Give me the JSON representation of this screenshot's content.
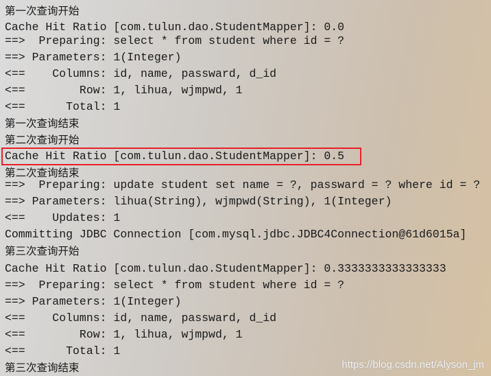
{
  "lines": [
    "第一次查询开始",
    "Cache Hit Ratio [com.tulun.dao.StudentMapper]: 0.0",
    "==>  Preparing: select * from student where id = ?",
    "==> Parameters: 1(Integer)",
    "<==    Columns: id, name, passward, d_id",
    "<==        Row: 1, lihua, wjmpwd, 1",
    "<==      Total: 1",
    "第一次查询结束",
    "第二次查询开始",
    "Cache Hit Ratio [com.tulun.dao.StudentMapper]: 0.5",
    "第二次查询结束",
    "==>  Preparing: update student set name = ?, passward = ? where id = ?",
    "==> Parameters: lihua(String), wjmpwd(String), 1(Integer)",
    "<==    Updates: 1",
    "Committing JDBC Connection [com.mysql.jdbc.JDBC4Connection@61d6015a]",
    "第三次查询开始",
    "Cache Hit Ratio [com.tulun.dao.StudentMapper]: 0.3333333333333333",
    "==>  Preparing: select * from student where id = ?",
    "==> Parameters: 1(Integer)",
    "<==    Columns: id, name, passward, d_id",
    "<==        Row: 1, lihua, wjmpwd, 1",
    "<==      Total: 1",
    "第三次查询结束"
  ],
  "highlight_color": "#e8202a",
  "watermark": "https://blog.csdn.net/Alyson_jm"
}
